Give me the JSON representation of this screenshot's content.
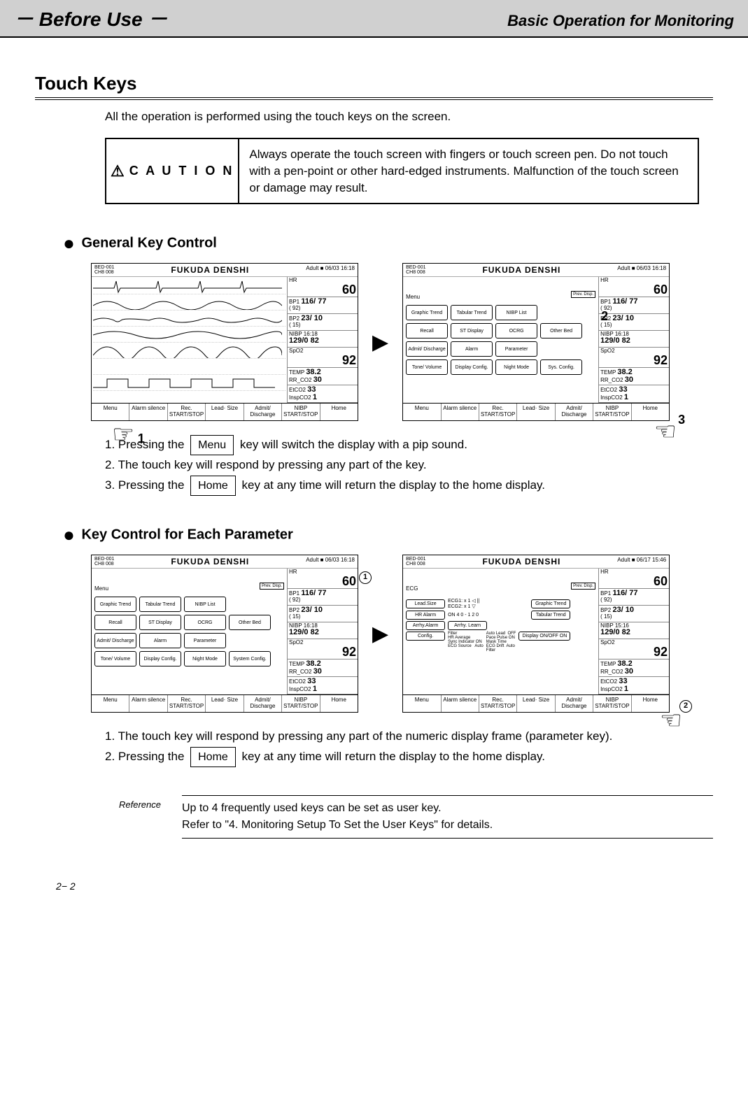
{
  "header": {
    "left": "－  Before Use  －",
    "right": "Basic Operation for Monitoring"
  },
  "section_title": "Touch Keys",
  "intro": "All the operation is performed using the touch keys on the screen.",
  "caution": {
    "label": "C A U T I O N",
    "text": "Always operate the touch screen with fingers or touch screen pen.   Do not touch with a pen-point or other hard-edged instruments.   Malfunction of the touch screen or damage may result."
  },
  "sub1": "General Key Control",
  "sub2": "Key Control for Each Parameter",
  "monitor": {
    "bed": "BED-001",
    "ch": "CH8 008",
    "brand": "FUKUDA DENSHI",
    "mode": "Adult",
    "datetime1": "06/03 16:18",
    "datetime2": "06/17 15:46",
    "hr_label": "HR",
    "hr": "60",
    "bp1_label": "BP1",
    "bp1": "116/  77",
    "bp1_mean": "(  92)",
    "bp2_label": "BP2",
    "bp2": "23/  10",
    "bp2_mean": "(  15)",
    "nibp_label": "NIBP",
    "nibp_time": "16:18",
    "nibp": "129/0  82",
    "spo2_label": "SpO2",
    "spo2": "92",
    "temp_label": "TEMP",
    "temp": "38.2",
    "rr_label": "RR_CO2",
    "rr": "30",
    "etco2_label": "EtCO2",
    "etco2": "33",
    "inspco2_label": "InspCO2",
    "inspco2": "1",
    "nibp_time2": "15:16",
    "keys": [
      "Menu",
      "Alarm silence",
      "Rec. START/STOP",
      "Lead· Size",
      "Admit/ Discharge",
      "NIBP START/STOP",
      "Home"
    ],
    "menu_items": [
      "Graphic Trend",
      "Tabular Trend",
      "NIBP List",
      "",
      "Recall",
      "ST Display",
      "OCRG",
      "Other Bed",
      "Admit/ Discharge",
      "Alarm",
      "Parameter",
      "",
      "Tone/ Volume",
      "Display Config.",
      "Night Mode",
      "System Config."
    ],
    "menu_items_short": [
      "Graphic Trend",
      "Tabular Trend",
      "NIBP List",
      "",
      "Recall",
      "ST Display",
      "OCRG",
      "Other Bed",
      "Admit/ Discharge",
      "Alarm",
      "Parameter",
      "",
      "Tone/ Volume",
      "Display Config.",
      "Night Mode",
      "Sys. Config."
    ],
    "prev_disp": "Prev. Disp.",
    "menu_label": "Menu",
    "ecg_label": "ECG",
    "ecg": {
      "lead_size": "Lead.Size",
      "ecg1": "ECG1:",
      "ecg2": "ECG2:",
      "x1a": "x 1",
      "x1b": "x 1",
      "hr_alarm": "HR Alarm",
      "hr_alarm_val": "ON       4 0 - 1 2 0",
      "arrhy_alarm": "Arrhy.Alarm",
      "arrhy_learn": "Arrhy. Learn",
      "config": "Config.",
      "config_lines": "Filter\nHR Average\nSync Indicator ON\nECG Source   Auto",
      "config_lines2": "Auto Lead  OFF\nPace Pulse ON\nMask Time\nECG Drift  Auto\nFilter",
      "side_btns": [
        "Graphic Trend",
        "Tabular Trend",
        "Display ON/OFF ON"
      ]
    }
  },
  "callouts": {
    "c1": "1",
    "c2": "2",
    "c3": "3"
  },
  "circled": {
    "c1": "1",
    "c2": "2"
  },
  "steps1": {
    "s1a": "1. Pressing the ",
    "s1b": " key will switch the display with a pip sound.",
    "s2": "2. The touch key will respond by pressing any part of the key.",
    "s3a": "3. Pressing the ",
    "s3b": " key at any time will return the display to the home display.",
    "menu_key": "Menu",
    "home_key": "Home"
  },
  "steps2": {
    "s1": "1. The touch key will respond by pressing any part of the numeric display frame (parameter key).",
    "s2a": "2. Pressing the ",
    "s2b": " key at any time will return the display to the home display.",
    "home_key": "Home"
  },
  "reference": {
    "label": "Reference",
    "line1": "Up to 4 frequently used keys can be set as user key.",
    "line2": "Refer to \"4. Monitoring Setup   To Set the User Keys\" for details."
  },
  "page_num": "2− 2"
}
